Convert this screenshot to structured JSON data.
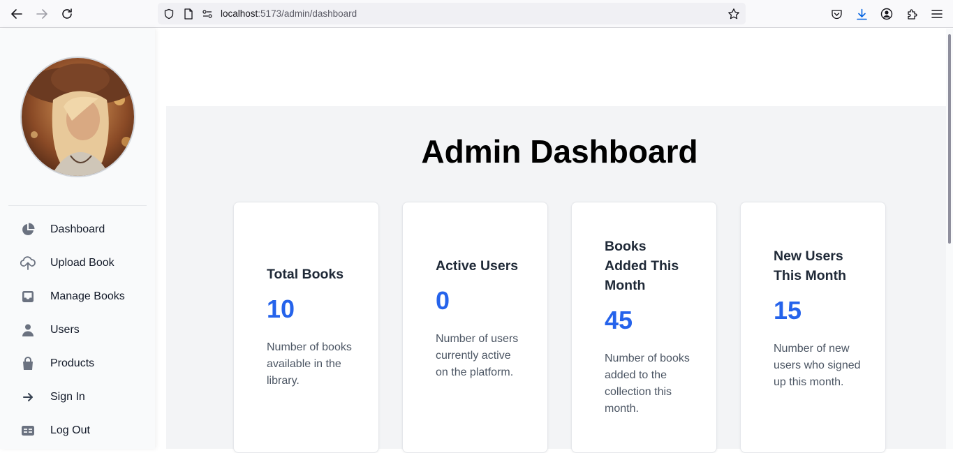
{
  "browser": {
    "url_host": "localhost",
    "url_path": ":5173/admin/dashboard"
  },
  "sidebar": {
    "items": [
      {
        "label": "Dashboard",
        "icon": "pie-chart-icon"
      },
      {
        "label": "Upload Book",
        "icon": "cloud-upload-icon"
      },
      {
        "label": "Manage Books",
        "icon": "inbox-icon"
      },
      {
        "label": "Users",
        "icon": "user-icon"
      },
      {
        "label": "Products",
        "icon": "shopping-bag-icon"
      },
      {
        "label": "Sign In",
        "icon": "arrow-right-icon"
      },
      {
        "label": "Log Out",
        "icon": "table-icon"
      }
    ]
  },
  "main": {
    "title": "Admin Dashboard",
    "cards": [
      {
        "title": "Total Books",
        "value": "10",
        "description": "Number of books available in the library."
      },
      {
        "title": "Active Users",
        "value": "0",
        "description": "Number of users currently active on the platform."
      },
      {
        "title": "Books Added This Month",
        "value": "45",
        "description": "Number of books added to the collection this month."
      },
      {
        "title": "New Users This Month",
        "value": "15",
        "description": "Number of new users who signed up this month."
      }
    ]
  },
  "colors": {
    "accent": "#2563eb",
    "sidebar_bg": "#f9fafb",
    "main_bg": "#f3f4f6"
  }
}
